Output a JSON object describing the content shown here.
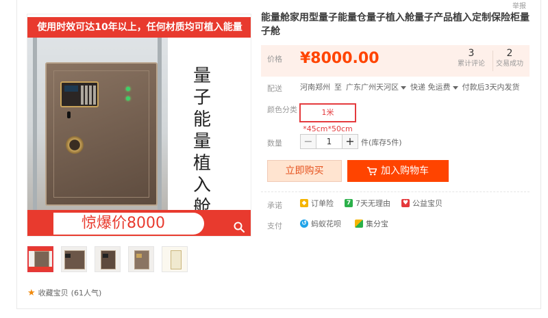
{
  "report_link": "举报",
  "main_image": {
    "top_banner": "使用时效可达10年以上，任何材质均可植入能量",
    "side_text": "量子能量植入舱",
    "price_banner": "惊爆价8000",
    "zoom_icon": "magnifier-icon"
  },
  "thumbnails": [
    {
      "alt": "thumb-1",
      "active": true
    },
    {
      "alt": "thumb-2",
      "active": false
    },
    {
      "alt": "thumb-3",
      "active": false
    },
    {
      "alt": "thumb-4",
      "active": false
    },
    {
      "alt": "thumb-5",
      "active": false
    }
  ],
  "favorite": {
    "label": "收藏宝贝",
    "count": "(61人气)"
  },
  "product": {
    "title": "能量舱家用型量子能量仓量子植入舱量子产品植入定制保险柜量子舱"
  },
  "price": {
    "label": "价格",
    "value": "¥8000.00",
    "reviews_num": "3",
    "reviews_label": "累计评论",
    "deals_num": "2",
    "deals_label": "交易成功"
  },
  "shipping": {
    "label": "配送",
    "from": "河南郑州",
    "to_prefix": "至",
    "to": "广东广州天河区",
    "method": "快递 免运费",
    "note": "付款后3天内发货"
  },
  "sku": {
    "label": "颜色分类",
    "option": "1米*45cm*50cm"
  },
  "quantity": {
    "label": "数量",
    "minus": "−",
    "value": "1",
    "plus": "+",
    "stock": "件(库存5件)"
  },
  "actions": {
    "buy_now": "立即购买",
    "add_cart": "加入购物车"
  },
  "promise": {
    "label": "承诺",
    "items": [
      "订单险",
      "7天无理由",
      "公益宝贝"
    ]
  },
  "payment": {
    "label": "支付",
    "items": [
      "蚂蚁花呗",
      "集分宝"
    ]
  },
  "colors": {
    "accent": "#ff4400",
    "banner_red": "#e83a2e",
    "price_orange": "#f40"
  }
}
